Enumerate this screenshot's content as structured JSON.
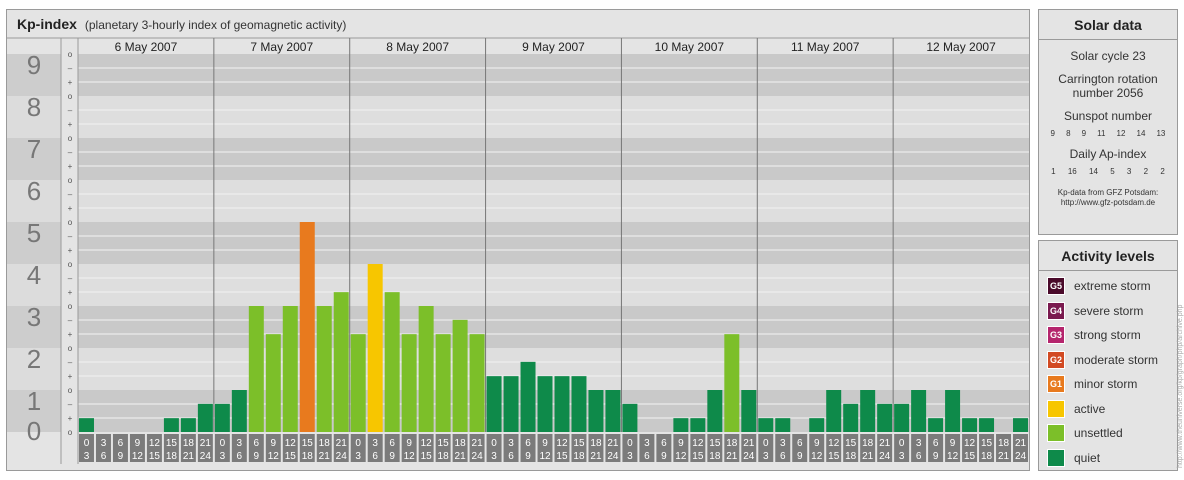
{
  "header": {
    "title": "Kp-index",
    "subtitle": "(planetary 3-hourly index of geomagnetic activity)"
  },
  "colors": {
    "quiet": "#0e8a4a",
    "unsettled": "#7cbf29",
    "active": "#f7c600",
    "minor": "#e87a1e",
    "moderate": "#d24a23",
    "strong": "#b5256d",
    "severe": "#7a1a4f",
    "extreme": "#4a0a2a"
  },
  "chart_data": {
    "type": "bar",
    "title": "Kp-index",
    "ylim": [
      0,
      9
    ],
    "y_ticks": [
      "0",
      "1",
      "2",
      "3",
      "4",
      "5",
      "6",
      "7",
      "8",
      "9"
    ],
    "sub_ticks": [
      "–",
      "o",
      "+"
    ],
    "days": [
      "6 May 2007",
      "7 May 2007",
      "8 May 2007",
      "9 May 2007",
      "10 May 2007",
      "11 May 2007",
      "12 May 2007"
    ],
    "intervals": [
      [
        "0",
        "3"
      ],
      [
        "3",
        "6"
      ],
      [
        "6",
        "9"
      ],
      [
        "9",
        "12"
      ],
      [
        "12",
        "15"
      ],
      [
        "15",
        "18"
      ],
      [
        "18",
        "21"
      ],
      [
        "21",
        "24"
      ]
    ],
    "values": [
      0.33,
      0,
      0,
      0,
      0,
      0.33,
      0.33,
      0.67,
      0.67,
      1,
      3,
      2.33,
      3,
      5,
      3,
      3.33,
      2.33,
      4,
      3.33,
      2.33,
      3,
      2.33,
      2.67,
      2.33,
      1.33,
      1.33,
      1.67,
      1.33,
      1.33,
      1.33,
      1,
      1,
      0.67,
      0,
      0,
      0.33,
      0.33,
      1,
      2.33,
      1,
      0.33,
      0.33,
      0,
      0.33,
      1,
      0.67,
      1,
      0.67,
      0.67,
      1,
      0.33,
      1,
      0.33,
      0.33,
      0,
      0.33
    ]
  },
  "solar": {
    "title": "Solar data",
    "cycle": "Solar cycle 23",
    "rotation_line1": "Carrington rotation",
    "rotation_line2": "number 2056",
    "sunspot_label": "Sunspot number",
    "sunspot_values": [
      "9",
      "8",
      "9",
      "11",
      "12",
      "14",
      "13"
    ],
    "ap_label": "Daily Ap-index",
    "ap_values": [
      "1",
      "16",
      "14",
      "5",
      "3",
      "2",
      "2"
    ],
    "source_line1": "Kp-data from GFZ Potsdam:",
    "source_line2": "http://www.gfz-potsdam.de"
  },
  "levels": {
    "title": "Activity levels",
    "items": [
      {
        "badge": "G5",
        "label": "extreme storm",
        "color": "#4a0a2a"
      },
      {
        "badge": "G4",
        "label": "severe storm",
        "color": "#7a1a4f"
      },
      {
        "badge": "G3",
        "label": "strong storm",
        "color": "#b5256d"
      },
      {
        "badge": "G2",
        "label": "moderate storm",
        "color": "#d24a23"
      },
      {
        "badge": "G1",
        "label": "minor storm",
        "color": "#e87a1e"
      },
      {
        "badge": "",
        "label": "active",
        "color": "#f7c600"
      },
      {
        "badge": "",
        "label": "unsettled",
        "color": "#7cbf29"
      },
      {
        "badge": "",
        "label": "quiet",
        "color": "#0e8a4a"
      }
    ]
  },
  "watermark": "http://www.theuniverse.org/kp/graph/php/archive.php"
}
